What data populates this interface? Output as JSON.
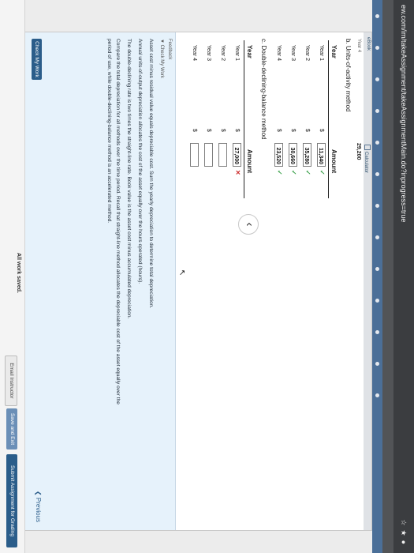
{
  "browser": {
    "url": "ew.com/im/takeAssignment/takeAssignmentMain.do?inprogress=true",
    "toolbar_icons": [
      "star-icon",
      "extension-icon",
      "profile-icon"
    ]
  },
  "tabs": {
    "ebook": "eBook",
    "calculator": "Calculator"
  },
  "fragment": {
    "label": "Year 4",
    "value": "29,200"
  },
  "part_b": {
    "title": "b. Units-of-activity method",
    "col_year": "Year",
    "col_amount": "Amount",
    "rows": [
      {
        "year": "Year 1",
        "currency": "$",
        "amount": "11,340",
        "status": "correct"
      },
      {
        "year": "Year 2",
        "currency": "$",
        "amount": "35,280",
        "status": "correct"
      },
      {
        "year": "Year 3",
        "currency": "$",
        "amount": "30,660",
        "status": "correct"
      },
      {
        "year": "Year 4",
        "currency": "$",
        "amount": "23,520",
        "status": "correct"
      }
    ]
  },
  "part_c": {
    "title": "c. Double-declining-balance method",
    "col_year": "Year",
    "col_amount": "Amount",
    "rows": [
      {
        "year": "Year 1",
        "currency": "$",
        "amount": "27,000",
        "status": "incorrect"
      },
      {
        "year": "Year 2",
        "currency": "$",
        "amount": "",
        "status": "blank"
      },
      {
        "year": "Year 3",
        "currency": "$",
        "amount": "",
        "status": "blank"
      },
      {
        "year": "Year 4",
        "currency": "$",
        "amount": "",
        "status": "blank"
      }
    ]
  },
  "feedback": {
    "title": "Feedback",
    "subtitle": "▼ Check My Work",
    "lines": [
      "Asset cost minus residual value equals depreciable cost. Sum the yearly depreciation to determine total depreciation.",
      "Annual units-of-output depreciation allocates the cost of the asset equally over the hours operated (hours).",
      "The double-declining rate is two times the straight-line rate. Book value is the asset cost minus accumulated depreciation.",
      "Compare the total depreciation for all methods over the time period. Recall that straight-line method allocates the depreciable cost of the asset equally over the",
      "period of use, while double-declining-balance method is an accelerated method."
    ]
  },
  "actions": {
    "check_my_work": "Check My Work",
    "previous": "Previous",
    "previous_glyph": "‹",
    "cursor": "↖"
  },
  "footer": {
    "saved": "All work saved.",
    "email": "Email Instructor",
    "save_exit": "Save and Exit",
    "submit": "Submit Assignment for Grading"
  },
  "colors": {
    "correct": "#3aa04a",
    "incorrect": "#cc2a2a",
    "brand": "#2b5d8a"
  }
}
